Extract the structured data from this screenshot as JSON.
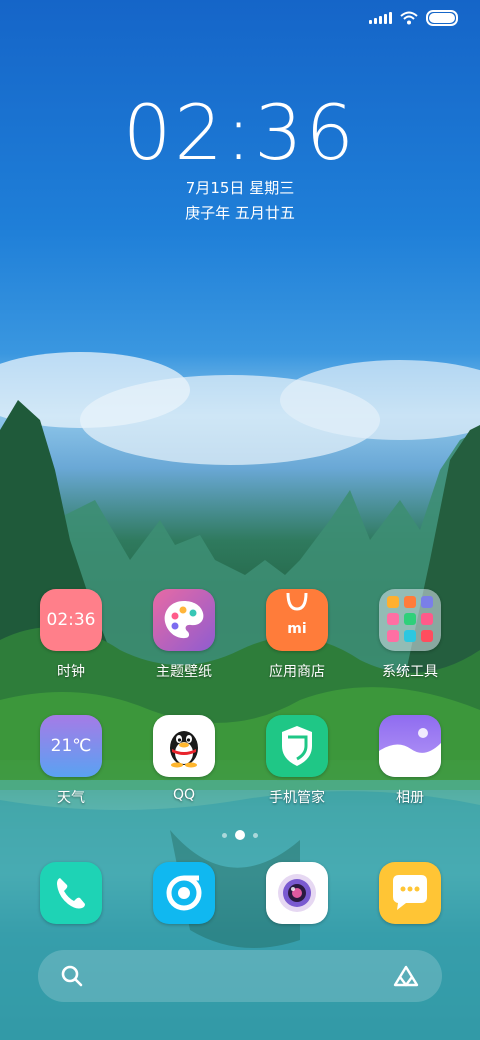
{
  "status_bar": {
    "signal_icon": "signal-icon",
    "wifi_icon": "wifi-icon",
    "battery_icon": "battery-icon",
    "battery_level": 1.0
  },
  "clock": {
    "time": "02:36",
    "date": "7月15日 星期三",
    "lunar_date": "庚子年 五月廿五"
  },
  "apps": [
    {
      "label": "时钟",
      "icon": "clock-icon",
      "icon_text": "02:36",
      "color": "#ff7f8a"
    },
    {
      "label": "主题壁纸",
      "icon": "palette-icon",
      "color": "#c466b8"
    },
    {
      "label": "应用商店",
      "icon": "store-bag-icon",
      "icon_text": "mi",
      "color": "#ff7c3a"
    },
    {
      "label": "系统工具",
      "icon": "folder-icon",
      "color": "#9ab3c8"
    },
    {
      "label": "天气",
      "icon": "weather-icon",
      "icon_text": "21℃",
      "color": "#6f9df0"
    },
    {
      "label": "QQ",
      "icon": "qq-penguin-icon",
      "color": "#ffffff"
    },
    {
      "label": "手机管家",
      "icon": "shield-icon",
      "color": "#1fc786"
    },
    {
      "label": "相册",
      "icon": "gallery-icon",
      "color": "#8f6cf0"
    }
  ],
  "page_indicator": {
    "current": 2,
    "total": 3
  },
  "dock": [
    {
      "name": "phone",
      "icon": "phone-icon",
      "color": "#1ed3b5"
    },
    {
      "name": "browser",
      "icon": "browser-icon",
      "color": "#10b8f0"
    },
    {
      "name": "camera",
      "icon": "camera-icon",
      "color": "#ffffff"
    },
    {
      "name": "messages",
      "icon": "message-icon",
      "color": "#ffc535"
    }
  ],
  "search_bar": {
    "search_icon": "search-icon",
    "assistant_icon": "assistant-icon"
  }
}
